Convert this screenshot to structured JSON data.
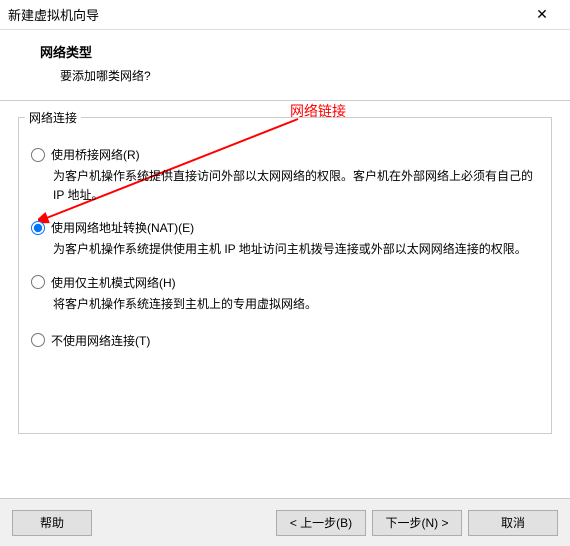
{
  "window": {
    "title": "新建虚拟机向导"
  },
  "header": {
    "title": "网络类型",
    "subtitle": "要添加哪类网络?"
  },
  "group": {
    "legend": "网络连接"
  },
  "options": {
    "bridge": {
      "label": "使用桥接网络(R)",
      "desc": "为客户机操作系统提供直接访问外部以太网网络的权限。客户机在外部网络上必须有自己的 IP 地址。"
    },
    "nat": {
      "label": "使用网络地址转换(NAT)(E)",
      "desc": "为客户机操作系统提供使用主机 IP 地址访问主机拨号连接或外部以太网网络连接的权限。"
    },
    "hostonly": {
      "label": "使用仅主机模式网络(H)",
      "desc": "将客户机操作系统连接到主机上的专用虚拟网络。"
    },
    "none": {
      "label": "不使用网络连接(T)"
    }
  },
  "annotation": {
    "label": "网络链接"
  },
  "buttons": {
    "help": "帮助",
    "back": "< 上一步(B)",
    "next": "下一步(N) >",
    "cancel": "取消"
  }
}
